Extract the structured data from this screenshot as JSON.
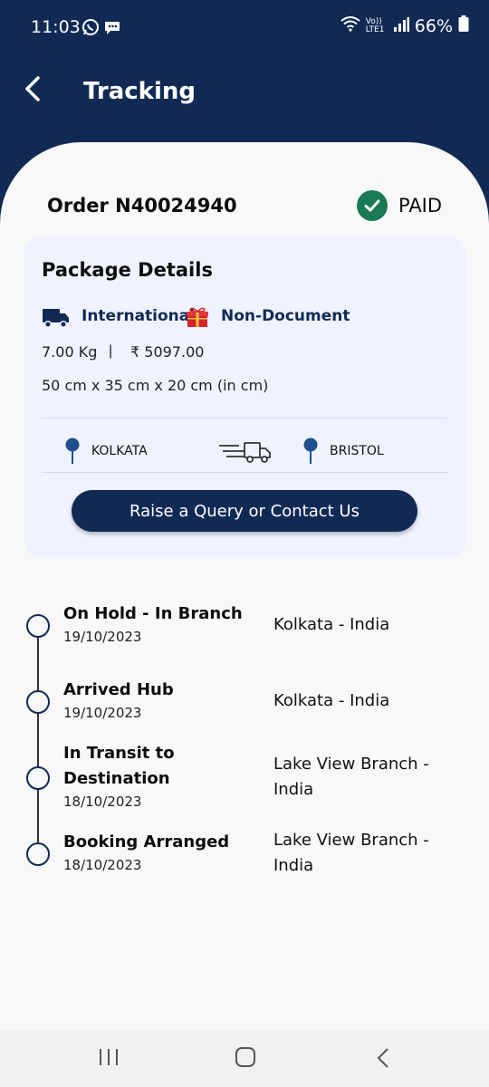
{
  "status_bar": {
    "time": "11:03",
    "network_label": "Vo)) LTE1",
    "battery": "66%"
  },
  "header": {
    "title": "Tracking",
    "back_icon": "chevron-left-icon"
  },
  "order": {
    "label": "Order N40024940",
    "payment_status": "PAID"
  },
  "package": {
    "title": "Package Details",
    "shipping_type": "International",
    "content_type": "Non-Document",
    "weight": "7.00 Kg",
    "separator": "|",
    "price": "₹ 5097.00",
    "dimensions": "50 cm x 35 cm x 20 cm (in cm)",
    "from": "KOLKATA",
    "to": "BRISTOL",
    "query_button": "Raise a Query or Contact Us"
  },
  "timeline": [
    {
      "status": "On Hold - In Branch",
      "date": "19/10/2023",
      "location": "Kolkata - India"
    },
    {
      "status": "Arrived Hub",
      "date": "19/10/2023",
      "location": "Kolkata - India"
    },
    {
      "status": "In Transit to Destination",
      "date": "18/10/2023",
      "location": "Lake View Branch - India"
    },
    {
      "status": "Booking Arranged",
      "date": "18/10/2023",
      "location": "Lake View Branch - India"
    }
  ],
  "colors": {
    "primary": "#102a54",
    "paid_green": "#1a7a53",
    "card_bg": "#eef3ff",
    "gift_red": "#d8232a"
  }
}
